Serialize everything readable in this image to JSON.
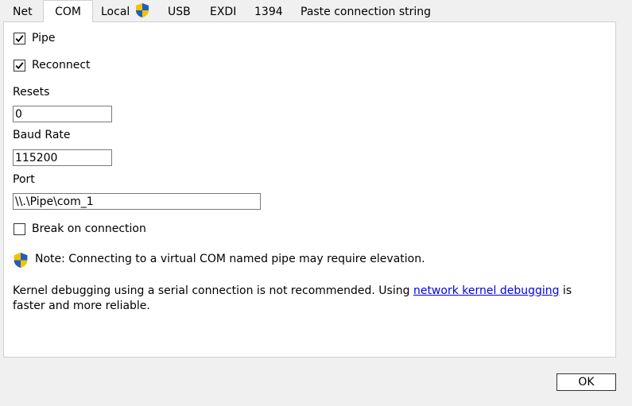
{
  "tabs": [
    {
      "label": "Net"
    },
    {
      "label": "COM",
      "active": true
    },
    {
      "label": "Local",
      "icon": "uac-shield-icon"
    },
    {
      "label": "USB"
    },
    {
      "label": "EXDI"
    },
    {
      "label": "1394"
    },
    {
      "label": "Paste connection string"
    }
  ],
  "com": {
    "pipe": {
      "label": "Pipe",
      "checked": true
    },
    "reconnect": {
      "label": "Reconnect",
      "checked": true
    },
    "resets": {
      "label": "Resets",
      "value": "0"
    },
    "baud_rate": {
      "label": "Baud Rate",
      "value": "115200"
    },
    "port": {
      "label": "Port",
      "value": "\\\\.\\Pipe\\com_1"
    },
    "break_on_connection": {
      "label": "Break on connection",
      "checked": false
    },
    "note": "Note: Connecting to a virtual COM named pipe may require elevation.",
    "info": {
      "before_link": "Kernel debugging using a serial connection is not recommended. Using ",
      "link": "network kernel debugging",
      "after_link": " is",
      "line2": "faster and more reliable."
    }
  },
  "footer": {
    "ok_label": "OK"
  },
  "colors": {
    "link": "#0000ee",
    "shield_blue": "#1f5fbf",
    "shield_yellow": "#f2c200",
    "panel_background": "#ffffff",
    "window_background": "#f0f0f0"
  }
}
